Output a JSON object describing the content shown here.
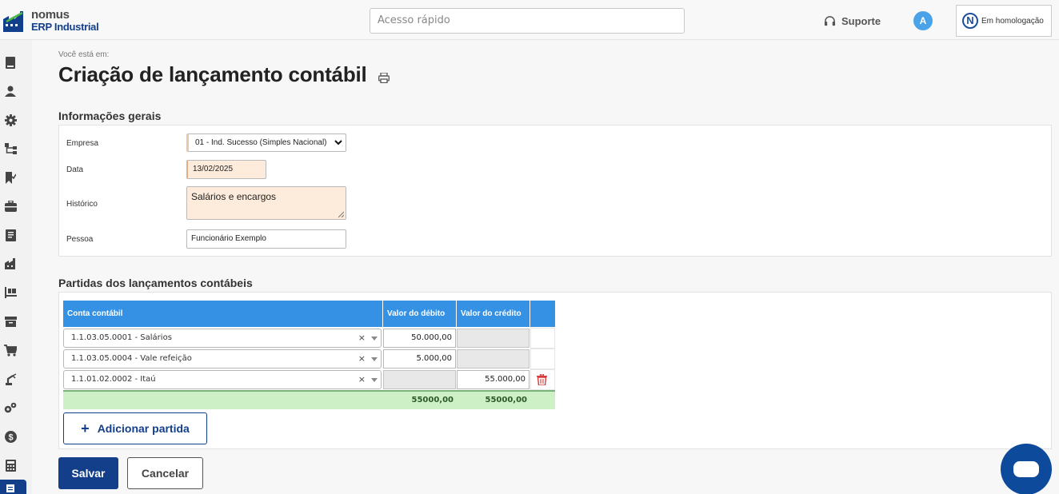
{
  "header": {
    "logo_line1": "nomus",
    "logo_line2": "ERP Industrial",
    "quick_access_placeholder": "Acesso rápido",
    "support_label": "Suporte",
    "user_initial": "A",
    "environment_label": "Em homologação",
    "environment_logo_letter": "N"
  },
  "sidebar": {
    "icons": [
      "book-icon",
      "user-icon",
      "gear-icon",
      "hierarchy-icon",
      "bookmark-check-icon",
      "briefcase-icon",
      "report-icon",
      "factory-icon",
      "pallet-icon",
      "archive-icon",
      "cart-icon",
      "robot-arm-icon",
      "gears-icon",
      "dollar-icon",
      "calculator-icon",
      "document-icon"
    ],
    "active_index": 15
  },
  "page": {
    "breadcrumb": "Você está em:",
    "title": "Criação de lançamento contábil"
  },
  "general": {
    "section_title": "Informações gerais",
    "empresa_label": "Empresa",
    "empresa_value": "01 - Ind. Sucesso (Simples Nacional)",
    "data_label": "Data",
    "data_value": "13/02/2025",
    "historico_label": "Histórico",
    "historico_value": "Salários e encargos",
    "pessoa_label": "Pessoa",
    "pessoa_value": "Funcionário Exemplo"
  },
  "entries": {
    "section_title": "Partidas dos lançamentos contábeis",
    "columns": [
      "Conta contábil",
      "Valor do débito",
      "Valor do crédito"
    ],
    "rows": [
      {
        "conta": "1.1.03.05.0001 - Salários",
        "debito": "50.000,00",
        "credito": ""
      },
      {
        "conta": "1.1.03.05.0004 - Vale refeição",
        "debito": "5.000,00",
        "credito": ""
      },
      {
        "conta": "1.1.01.02.0002 - Itaú",
        "debito": "",
        "credito": "55.000,00"
      }
    ],
    "clear_symbol": "×",
    "total_debito": "55000,00",
    "total_credito": "55000,00",
    "add_button": "Adicionar partida",
    "add_symbol": "+"
  },
  "actions": {
    "save": "Salvar",
    "cancel": "Cancelar"
  },
  "colors": {
    "brand": "#133e8a",
    "table_header": "#3491e3",
    "totals_bg": "#cdf0c6",
    "required_field": "#fdebdb",
    "delete": "#d93a3a"
  }
}
